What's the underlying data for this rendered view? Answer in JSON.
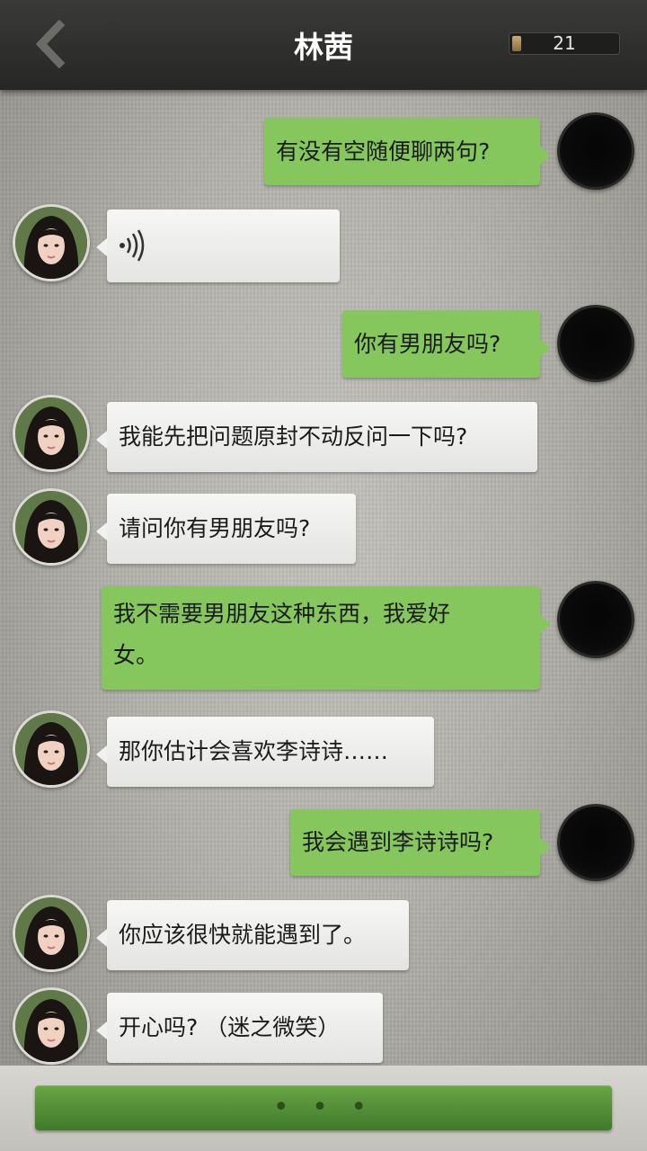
{
  "header": {
    "back_icon": "chevron-left-icon",
    "title": "林茜",
    "counter": "21"
  },
  "messages": [
    {
      "side": "out",
      "text": "有没有空随便聊两句?"
    },
    {
      "side": "in",
      "type": "voice",
      "icon": "voice-wave-icon"
    },
    {
      "side": "out",
      "text": "你有男朋友吗?"
    },
    {
      "side": "in",
      "text": "我能先把问题原封不动反问一下吗?"
    },
    {
      "side": "in",
      "text": "请问你有男朋友吗?"
    },
    {
      "side": "out",
      "text_line1": "我不需要男朋友这种东西，我爱好",
      "text_line2": "女。"
    },
    {
      "side": "in",
      "text": "那你估计会喜欢李诗诗……"
    },
    {
      "side": "out",
      "text": "我会遇到李诗诗吗?"
    },
    {
      "side": "in",
      "text": "你应该很快就能遇到了。"
    },
    {
      "side": "in",
      "text": "开心吗? （迷之微笑）"
    }
  ],
  "footer": {
    "reply_indicator": "• • •"
  },
  "colors": {
    "outgoing_bubble": "#85c75c",
    "incoming_bubble": "#f1f1ef",
    "header": "#2e2e2c",
    "reply_bar": "#5a9a3d"
  }
}
